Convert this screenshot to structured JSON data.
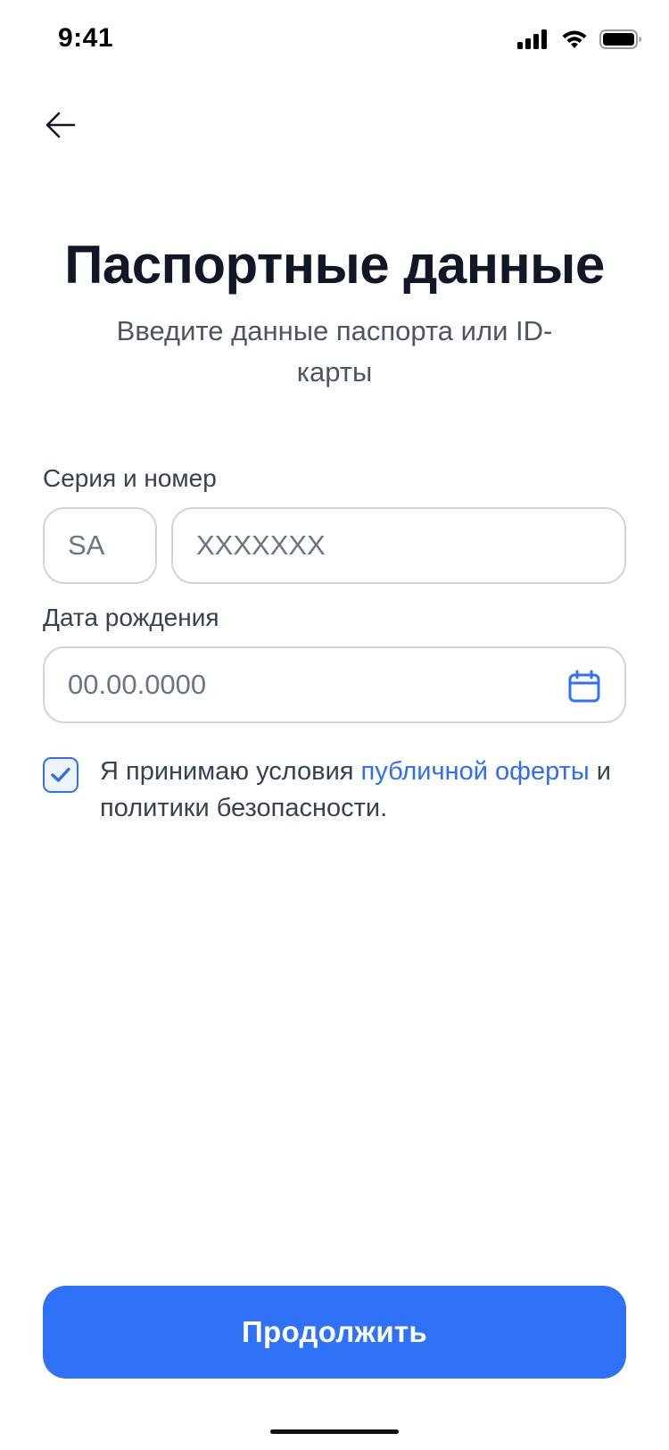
{
  "status_bar": {
    "time": "9:41",
    "icons": [
      "cellular-signal-icon",
      "wifi-icon",
      "battery-icon"
    ]
  },
  "header": {
    "back_icon": "arrow-left-icon"
  },
  "page": {
    "title": "Паспортные данные",
    "subtitle": "Введите данные паспорта или ID-карты"
  },
  "form": {
    "series_label": "Серия и номер",
    "series_placeholder": "SA",
    "series_value": "",
    "number_placeholder": "XXXXXXX",
    "number_value": "",
    "birth_label": "Дата рождения",
    "birth_placeholder": "00.00.0000",
    "birth_value": "",
    "calendar_icon": "calendar-icon"
  },
  "consent": {
    "checked": true,
    "text_before": "Я принимаю условия ",
    "link_text": "публичной оферты",
    "text_after": " и политики безопасности."
  },
  "footer": {
    "continue_label": "Продолжить"
  },
  "colors": {
    "accent": "#2F72F8",
    "title": "#101828",
    "subtitle": "#4B5565",
    "border": "#D0D5DD"
  }
}
